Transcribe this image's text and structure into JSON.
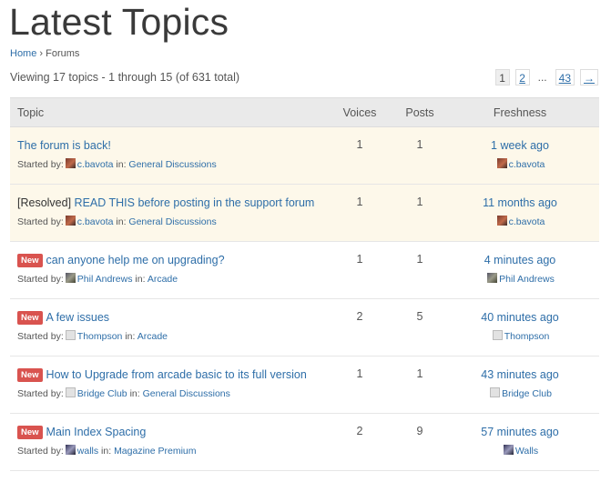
{
  "page": {
    "title": "Latest Topics"
  },
  "breadcrumb": {
    "home": "Home",
    "sep": "›",
    "current": "Forums"
  },
  "summary": "Viewing 17 topics - 1 through 15 (of 631 total)",
  "pagination": {
    "current": "1",
    "p2": "2",
    "dots": "...",
    "last": "43",
    "next": "→"
  },
  "table": {
    "headers": {
      "topic": "Topic",
      "voices": "Voices",
      "posts": "Posts",
      "freshness": "Freshness"
    },
    "started_by_label": "Started by:",
    "in_label": "in:",
    "new_badge": "New",
    "rows": [
      {
        "prefix": "",
        "title": "The forum is back!",
        "author": "c.bavota",
        "avatar": "photo",
        "forum": "General Discussions",
        "voices": "1",
        "posts": "1",
        "fresh_time": "1 week ago",
        "fresh_user": "c.bavota",
        "is_new": false,
        "sticky": true
      },
      {
        "prefix": "[Resolved]",
        "title": "READ THIS before posting in the support forum",
        "author": "c.bavota",
        "avatar": "photo",
        "forum": "General Discussions",
        "voices": "1",
        "posts": "1",
        "fresh_time": "11 months ago",
        "fresh_user": "c.bavota",
        "is_new": false,
        "sticky": true
      },
      {
        "prefix": "",
        "title": "can anyone help me on upgrading?",
        "author": "Phil Andrews",
        "avatar": "photo",
        "forum": "Arcade",
        "voices": "1",
        "posts": "1",
        "fresh_time": "4 minutes ago",
        "fresh_user": "Phil Andrews",
        "is_new": true,
        "sticky": false
      },
      {
        "prefix": "",
        "title": "A few issues",
        "author": "Thompson",
        "avatar": "blank",
        "forum": "Arcade",
        "voices": "2",
        "posts": "5",
        "fresh_time": "40 minutes ago",
        "fresh_user": "Thompson",
        "is_new": true,
        "sticky": false
      },
      {
        "prefix": "",
        "title": "How to Upgrade from arcade basic to its full version",
        "author": "Bridge Club",
        "avatar": "blank",
        "forum": "General Discussions",
        "voices": "1",
        "posts": "1",
        "fresh_time": "43 minutes ago",
        "fresh_user": "Bridge Club",
        "is_new": true,
        "sticky": false
      },
      {
        "prefix": "",
        "title": "Main Index Spacing",
        "author": "walls",
        "avatar": "photo",
        "forum": "Magazine Premium",
        "voices": "2",
        "posts": "9",
        "fresh_time": "57 minutes ago",
        "fresh_user": "Walls",
        "is_new": true,
        "sticky": false
      }
    ]
  },
  "colors": {
    "link": "#2e6ea8",
    "sticky_bg": "#fdf8ea",
    "badge_bg": "#d9534f",
    "header_bg": "#eaeaea"
  }
}
